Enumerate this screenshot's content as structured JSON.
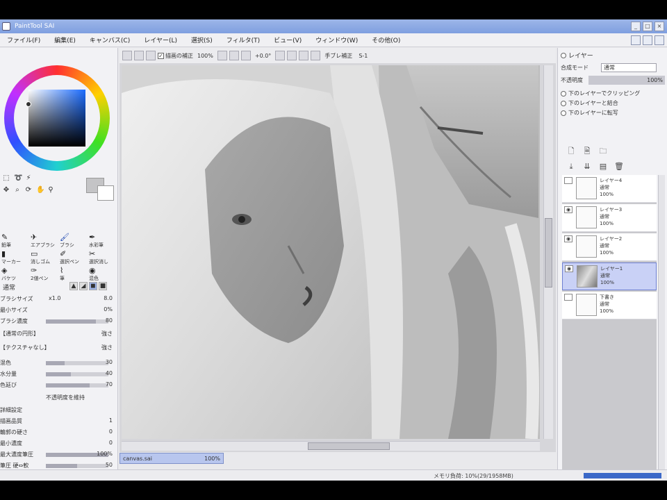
{
  "window": {
    "title": "PaintTool SAI",
    "minimize": "_",
    "maximize": "□",
    "close": "×"
  },
  "menu": [
    "ファイル(F)",
    "編集(E)",
    "キャンバス(C)",
    "レイヤー(L)",
    "選択(S)",
    "フィルタ(T)",
    "ビュー(V)",
    "ウィンドウ(W)",
    "その他(O)"
  ],
  "toolbar": {
    "antialias_label": "描画の補正",
    "zoom_value": "100%",
    "angle_value": "+0.0°",
    "stabilizer_label": "手ブレ補正",
    "stabilizer_value": "S-1"
  },
  "left_panel": {
    "tools": [
      "選択",
      "なげなわ",
      "自動選択",
      "移動",
      "ズーム",
      "回転",
      "手のひら",
      "スポイト"
    ],
    "brushes": [
      {
        "label": "鉛筆",
        "icon": "✎"
      },
      {
        "label": "エアブラシ",
        "icon": "✈"
      },
      {
        "label": "ブラシ",
        "icon": "🖌"
      },
      {
        "label": "水彩筆",
        "icon": "✒"
      },
      {
        "label": "マーカー",
        "icon": "▮"
      },
      {
        "label": "消しゴム",
        "icon": "▭"
      },
      {
        "label": "選択ペン",
        "icon": "✐"
      },
      {
        "label": "選択消し",
        "icon": "✂"
      },
      {
        "label": "バケツ",
        "icon": "◈"
      },
      {
        "label": "2値ペン",
        "icon": "✑"
      },
      {
        "label": "筆",
        "icon": "⌇"
      },
      {
        "label": "混色",
        "icon": "◉"
      }
    ],
    "brush_mode": "通常",
    "props": [
      {
        "label": "ブラシサイズ",
        "value": "x1.0",
        "extra": "8.0"
      },
      {
        "label": "最小サイズ",
        "value": "0%"
      },
      {
        "label": "ブラシ濃度",
        "value": "80",
        "fill": 0.8
      },
      {
        "label": "【通常の円形】",
        "value": "強さ"
      },
      {
        "label": "【テクスチャなし】",
        "value": "強さ"
      },
      {
        "label": "混色",
        "value": "30",
        "fill": 0.3
      },
      {
        "label": "水分量",
        "value": "40",
        "fill": 0.4
      },
      {
        "label": "色延び",
        "value": "70",
        "fill": 0.7
      },
      {
        "label": "不透明度を維持",
        "value": ""
      },
      {
        "label": "詳細設定",
        "value": ""
      },
      {
        "label": "描画品質",
        "value": "1"
      },
      {
        "label": "輪郭の硬さ",
        "value": "0"
      },
      {
        "label": "最小濃度",
        "value": "0"
      },
      {
        "label": "最大濃度筆圧",
        "value": "100%",
        "fill": 1.0
      },
      {
        "label": "筆圧 硬⇔軟",
        "value": "50",
        "fill": 0.5
      }
    ]
  },
  "canvas": {
    "nav_name": "canvas.sai",
    "nav_zoom": "100%"
  },
  "right_panel": {
    "title": "レイヤー",
    "blend_label": "合成モード",
    "blend_value": "通常",
    "opacity_label": "不透明度",
    "opacity_value": "100%",
    "options": [
      "下のレイヤーでクリッピング",
      "下のレイヤーと結合",
      "下のレイヤーに転写"
    ],
    "layers": [
      {
        "name": "レイヤー4",
        "mode": "通常",
        "opacity": "100%",
        "selected": false
      },
      {
        "name": "レイヤー3",
        "mode": "通常",
        "opacity": "100%",
        "selected": false
      },
      {
        "name": "レイヤー2",
        "mode": "通常",
        "opacity": "100%",
        "selected": false
      },
      {
        "name": "レイヤー1",
        "mode": "通常",
        "opacity": "100%",
        "selected": true
      },
      {
        "name": "下書き",
        "mode": "通常",
        "opacity": "100%",
        "selected": false
      }
    ]
  },
  "status": {
    "text": "メモリ負荷: 10%(29/1958MB)"
  },
  "colors": {
    "primary": "#c4c4c6",
    "secondary": "#ffffff",
    "accent": "#7f9fe0"
  }
}
